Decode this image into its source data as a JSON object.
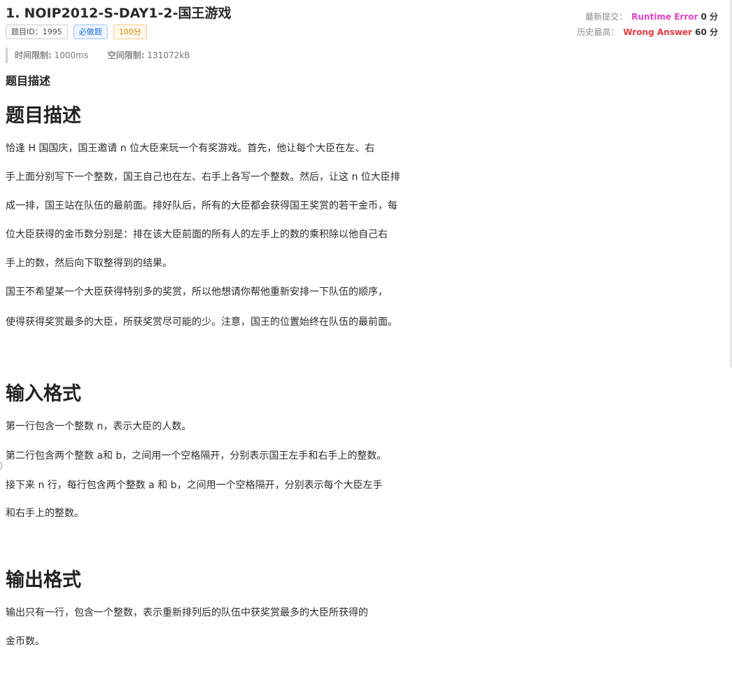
{
  "problem": {
    "number": "1.",
    "title": "NOIP2012-S-DAY1-2-国王游戏",
    "tags": {
      "id": "题目ID：1995",
      "required": "必做题",
      "score": "100分"
    }
  },
  "submission": {
    "latest_label": "最新提交：",
    "latest_status": "Runtime Error",
    "latest_score": "0 分",
    "best_label": "历史最高：",
    "best_status": "Wrong Answer",
    "best_score": "60 分",
    "colors": {
      "runtime_error": "#e040c8",
      "wrong_answer": "#e8383d"
    }
  },
  "limits": {
    "time_label": "时间限制:",
    "time_value": "1000ms",
    "space_label": "空间限制:",
    "space_value": "131072kB"
  },
  "content": {
    "section_small": "题目描述",
    "description_heading": "题目描述",
    "description": [
      "恰逢 H 国国庆，国王邀请 n 位大臣来玩一个有奖游戏。首先，他让每个大臣在左、右",
      "手上面分别写下一个整数，国王自己也在左、右手上各写一个整数。然后，让这 n 位大臣排",
      "成一排，国王站在队伍的最前面。排好队后，所有的大臣都会获得国王奖赏的若干金币，每",
      "位大臣获得的金币数分别是：排在该大臣前面的所有人的左手上的数的乘积除以他自己右",
      "手上的数，然后向下取整得到的结果。",
      "国王不希望某一个大臣获得特别多的奖赏，所以他想请你帮他重新安排一下队伍的顺序，",
      "使得获得奖赏最多的大臣，所获奖赏尽可能的少。注意，国王的位置始终在队伍的最前面。"
    ],
    "input_heading": "输入格式",
    "input": [
      "第一行包含一个整数 n，表示大臣的人数。",
      "第二行包含两个整数 a和 b，之间用一个空格隔开，分别表示国王左手和右手上的整数。",
      "接下来 n 行，每行包含两个整数 a 和 b，之间用一个空格隔开，分别表示每个大臣左手",
      "和右手上的整数。"
    ],
    "output_heading": "输出格式",
    "output": [
      "输出只有一行，包含一个整数，表示重新排列后的队伍中获奖赏最多的大臣所获得的",
      "金币数。"
    ]
  }
}
